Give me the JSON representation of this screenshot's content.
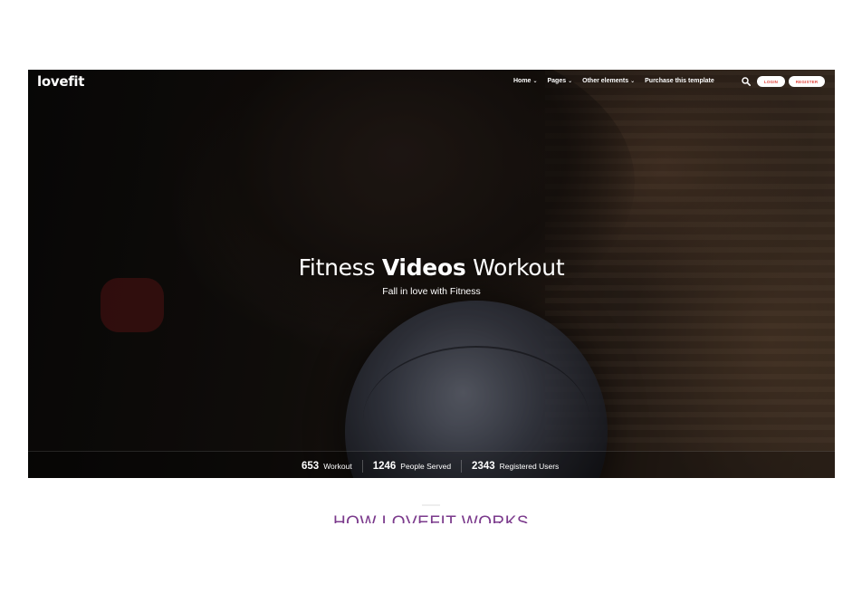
{
  "brand": {
    "logo_text": "lovefit"
  },
  "nav": {
    "items": [
      {
        "label": "Home",
        "has_dropdown": true
      },
      {
        "label": "Pages",
        "has_dropdown": true
      },
      {
        "label": "Other elements",
        "has_dropdown": true
      },
      {
        "label": "Purchase this template",
        "has_dropdown": false
      }
    ],
    "chevron": "⌄",
    "search_icon": "search-icon",
    "login_label": "LOGIN",
    "register_label": "REGISTER"
  },
  "hero": {
    "title_part1": "Fitness",
    "title_bold": "Videos",
    "title_part2": "Workout",
    "subtitle": "Fall in love with Fitness"
  },
  "stats": [
    {
      "number": "653",
      "label": "Workout"
    },
    {
      "number": "1246",
      "label": "People Served"
    },
    {
      "number": "2343",
      "label": "Registered Users"
    }
  ],
  "section": {
    "title": "HOW LOVEFIT WORKS"
  },
  "colors": {
    "accent_red": "#e0443c",
    "section_title_purple": "#7b3a8c",
    "hero_text": "#ffffff"
  }
}
